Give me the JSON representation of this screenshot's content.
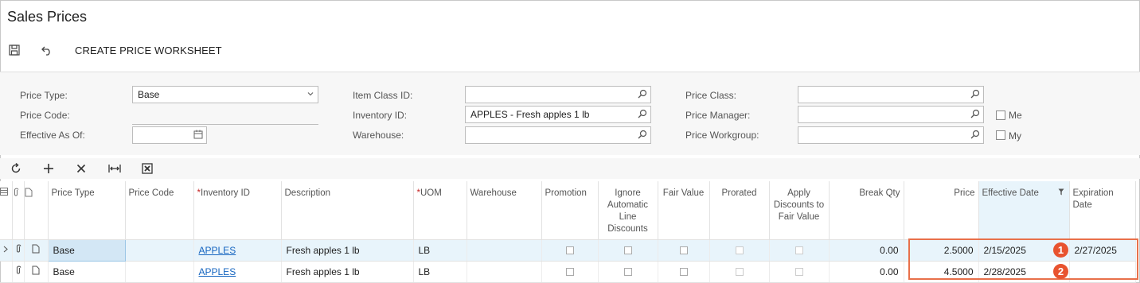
{
  "page": {
    "title": "Sales Prices"
  },
  "toolbar": {
    "save_icon": "save-icon",
    "undo_icon": "undo-icon",
    "create_worksheet_label": "CREATE PRICE WORKSHEET"
  },
  "filters": {
    "price_type": {
      "label": "Price Type:",
      "value": "Base"
    },
    "price_code": {
      "label": "Price Code:",
      "value": ""
    },
    "effective_as_of": {
      "label": "Effective As Of:",
      "value": ""
    },
    "item_class_id": {
      "label": "Item Class ID:",
      "value": ""
    },
    "inventory_id": {
      "label": "Inventory ID:",
      "value": "APPLES - Fresh apples 1 lb"
    },
    "warehouse": {
      "label": "Warehouse:",
      "value": ""
    },
    "price_class": {
      "label": "Price Class:",
      "value": ""
    },
    "price_manager": {
      "label": "Price Manager:",
      "value": ""
    },
    "price_workgroup": {
      "label": "Price Workgroup:",
      "value": ""
    },
    "me_label": "Me",
    "my_label": "My"
  },
  "grid": {
    "columns": {
      "price_type": "Price Type",
      "price_code": "Price Code",
      "inventory_id": "Inventory ID",
      "description": "Description",
      "uom": "UOM",
      "warehouse": "Warehouse",
      "promotion": "Promotion",
      "ignore_auto": "Ignore Automatic Line Discounts",
      "fair_value": "Fair Value",
      "prorated": "Prorated",
      "apply_discounts": "Apply Discounts to Fair Value",
      "break_qty": "Break Qty",
      "price": "Price",
      "effective_date": "Effective Date",
      "expiration_date": "Expiration Date"
    },
    "rows": [
      {
        "price_type": "Base",
        "price_code": "",
        "inventory_id": "APPLES",
        "description": "Fresh apples 1 lb",
        "uom": "LB",
        "warehouse": "",
        "break_qty": "0.00",
        "price": "2.5000",
        "effective_date": "2/15/2025",
        "expiration_date": "2/27/2025"
      },
      {
        "price_type": "Base",
        "price_code": "",
        "inventory_id": "APPLES",
        "description": "Fresh apples 1 lb",
        "uom": "LB",
        "warehouse": "",
        "break_qty": "0.00",
        "price": "4.5000",
        "effective_date": "2/28/2025",
        "expiration_date": ""
      }
    ]
  },
  "callouts": [
    "1",
    "2"
  ],
  "colors": {
    "accent": "#e8532f",
    "selected_row": "#e8f4fb",
    "link": "#1565c0"
  }
}
